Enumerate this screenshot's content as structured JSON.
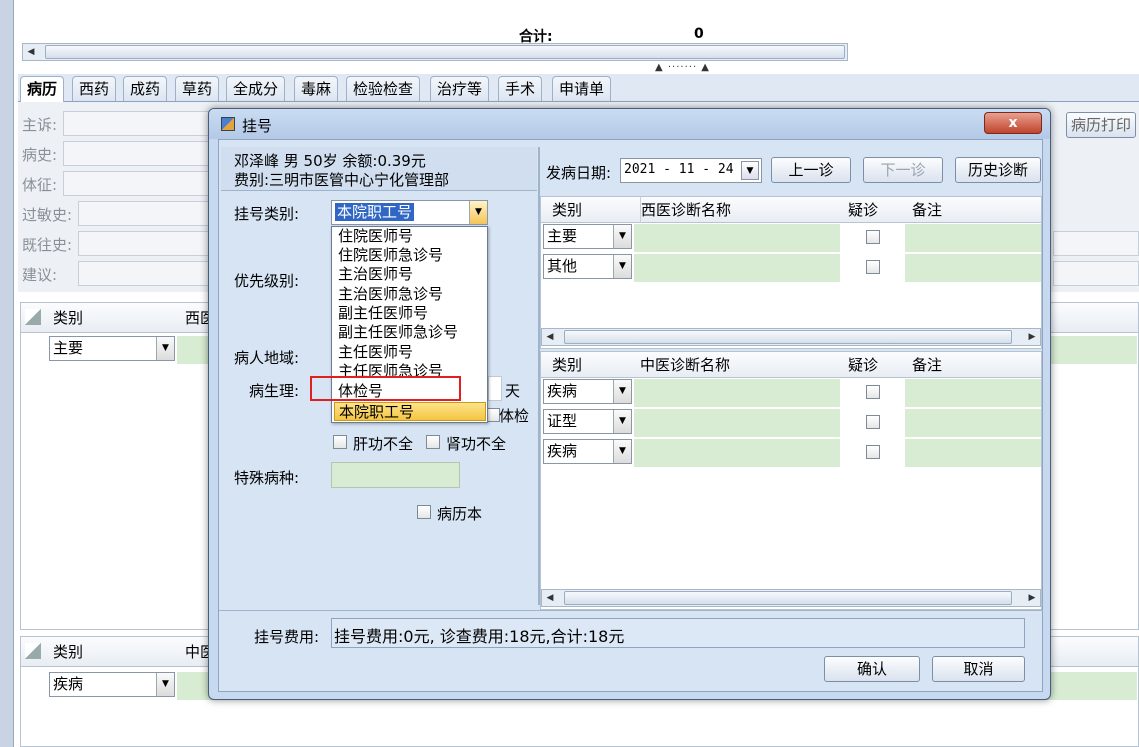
{
  "background": {
    "total_label": "合计:",
    "total_value": "0",
    "tabs": [
      "病历",
      "西药",
      "成药",
      "草药",
      "全成分",
      "毒麻",
      "检验检查",
      "治疗等",
      "手术",
      "申请单"
    ],
    "print_button": "病历打印",
    "form_labels": [
      "主诉:",
      "病史:",
      "体征:",
      "过敏史:",
      "既往史:",
      "建议:"
    ],
    "grid1": {
      "col_type": "类别",
      "col_name": "西医",
      "row_value": "主要"
    },
    "grid2": {
      "col_type": "类别",
      "col_name": "中医",
      "row_value": "疾病"
    }
  },
  "dialog": {
    "title": "挂号",
    "close_label": "x",
    "patient_line1": "邓泽峰 男 50岁 余额:0.39元",
    "patient_line2": "费别:三明市医管中心宁化管理部",
    "reg_type_label": "挂号类别:",
    "reg_type_value": "本院职工号",
    "priority_label": "优先级别:",
    "region_label": "病人地域:",
    "physio_label": "病生理:",
    "physio_suffix_days": "天",
    "physio_exam_label": "体检",
    "liver_label": "肝功不全",
    "kidney_label": "肾功不全",
    "special_label": "特殊病种:",
    "record_book_label": "病历本",
    "dropdown_options": [
      "住院医师号",
      "住院医师急诊号",
      "主治医师号",
      "主治医师急诊号",
      "副主任医师号",
      "副主任医师急诊号",
      "主任医师号",
      "主任医师急诊号",
      "体检号",
      "本院职工号"
    ],
    "dropdown_selected_index": 9,
    "dropdown_highlight_index": 8,
    "onset_label": "发病日期:",
    "onset_date": "2021 - 11 - 24",
    "prev_button": "上一诊",
    "next_button": "下一诊",
    "history_button": "历史诊断",
    "western": {
      "headers": [
        "类别",
        "西医诊断名称",
        "疑诊",
        "备注"
      ],
      "rows": [
        "主要",
        "其他"
      ]
    },
    "tcm": {
      "headers": [
        "类别",
        "中医诊断名称",
        "疑诊",
        "备注"
      ],
      "rows": [
        "疾病",
        "证型",
        "疾病"
      ]
    },
    "fee_label": "挂号费用:",
    "fee_text": "挂号费用:0元, 诊查费用:18元,合计:18元",
    "ok_button": "确认",
    "cancel_button": "取消"
  },
  "colors": {
    "highlight_box": "#e02020",
    "selected_item": "#f5c542",
    "grid_green": "#d8ecd3",
    "title_bar": "#b4c9e6"
  }
}
